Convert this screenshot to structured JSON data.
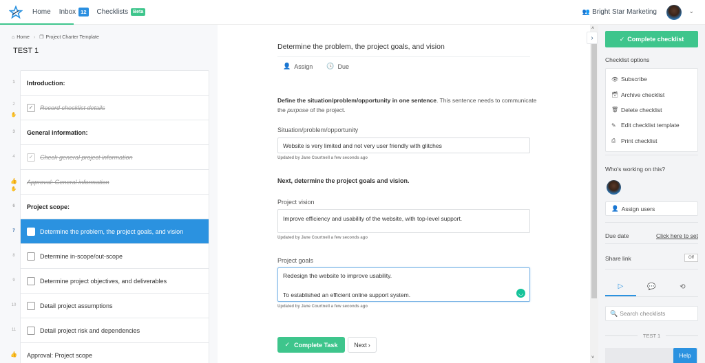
{
  "nav": {
    "home": "Home",
    "inbox": "Inbox",
    "inbox_count": "12",
    "checklists": "Checklists",
    "checklists_badge": "Beta",
    "organization": "Bright Star Marketing"
  },
  "breadcrumb": {
    "home": "Home",
    "template": "Project Charter Template"
  },
  "checklist_title": "TEST 1",
  "tasks": [
    {
      "num": "1",
      "label": "Introduction:",
      "type": "heading"
    },
    {
      "num": "2",
      "label": "Record checklist details",
      "type": "done"
    },
    {
      "num": "3",
      "label": "General information:",
      "type": "heading"
    },
    {
      "num": "4",
      "label": "Check general project information",
      "type": "done"
    },
    {
      "num": "",
      "label": "Approval: General information",
      "type": "approval-done"
    },
    {
      "num": "6",
      "label": "Project scope:",
      "type": "heading"
    },
    {
      "num": "7",
      "label": "Determine the problem, the project goals, and vision",
      "type": "active"
    },
    {
      "num": "8",
      "label": "Determine in-scope/out-scope",
      "type": "todo"
    },
    {
      "num": "9",
      "label": "Determine project objectives, and deliverables",
      "type": "todo"
    },
    {
      "num": "10",
      "label": "Detail project assumptions",
      "type": "todo"
    },
    {
      "num": "11",
      "label": "Detail project risk and dependencies",
      "type": "todo"
    },
    {
      "num": "",
      "label": "Approval: Project scope",
      "type": "approval"
    }
  ],
  "task_detail": {
    "title": "Determine the problem, the project goals, and vision",
    "assign_label": "Assign",
    "due_label": "Due",
    "desc_bold": "Define the situation/problem/opportunity in one sentence",
    "desc_pre": ". This sentence needs to communicate the ",
    "desc_em": "purpose",
    "desc_post": " of the project.",
    "field1_label": "Situation/problem/opportunity",
    "field1_value": "Website is very limited and not very user friendly with glitches",
    "updated_text": "Updated by Jane Courtnell a few seconds ago",
    "subhead": "Next, determine the project goals and vision.",
    "field2_label": "Project vision",
    "field2_value": "Improve efficiency and usability of the website, with top-level support.",
    "field3_label": "Project goals",
    "field3_line1": "Redesign the website to improve usability.",
    "field3_line2": "To established an efficient online support system.",
    "complete_task": "Complete Task",
    "next": "Next"
  },
  "right_panel": {
    "complete_checklist": "Complete checklist",
    "options_label": "Checklist options",
    "options": [
      {
        "icon": "eye-icon",
        "glyph": "👁",
        "label": "Subscribe"
      },
      {
        "icon": "archive-icon",
        "glyph": "🗃",
        "label": "Archive checklist"
      },
      {
        "icon": "trash-icon",
        "glyph": "🗑",
        "label": "Delete checklist"
      },
      {
        "icon": "pencil-icon",
        "glyph": "✎",
        "label": "Edit checklist template"
      },
      {
        "icon": "print-icon",
        "glyph": "⎙",
        "label": "Print checklist"
      }
    ],
    "working_label": "Who's working on this?",
    "assign_users": "Assign users",
    "due_date_label": "Due date",
    "due_date_link": "Click here to set",
    "share_link_label": "Share link",
    "share_link_state": "Off",
    "search_placeholder": "Search checklists",
    "section_label": "TEST 1"
  },
  "help": "Help",
  "colors": {
    "accent_green": "#3ec58c",
    "accent_blue": "#2b92e0"
  }
}
